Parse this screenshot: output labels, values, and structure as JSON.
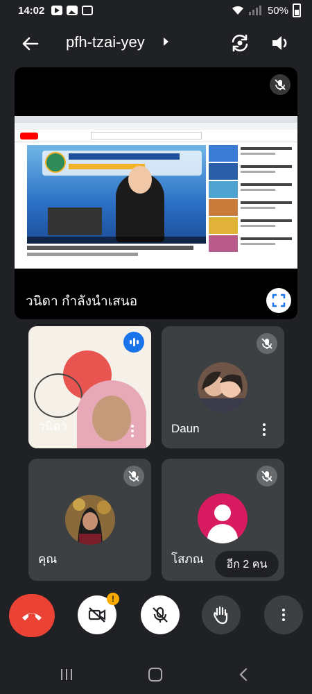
{
  "status_bar": {
    "time": "14:02",
    "battery": "50%"
  },
  "header": {
    "meeting_code": "pfh-tzai-yey"
  },
  "presenter": {
    "label": "วนิดา กำลังนำเสนอ"
  },
  "participants": [
    {
      "name": "วนิดา",
      "state": "speaking"
    },
    {
      "name": "Daun",
      "state": "muted"
    },
    {
      "name": "คุณ",
      "state": "muted"
    },
    {
      "name": "โสภณ",
      "state": "muted"
    }
  ],
  "others": {
    "label": "อีก 2 คน"
  },
  "controls": {
    "camera_warning": "!"
  },
  "colors": {
    "background": "#202124",
    "tile": "#3c4043",
    "end_call": "#ea4335",
    "speaking": "#1a73e8",
    "avatar_pink": "#d81b60",
    "warning": "#f9ab00"
  },
  "icons": [
    "back-arrow-icon",
    "caret-right-icon",
    "switch-camera-icon",
    "speaker-icon",
    "mic-off-icon",
    "fullscreen-icon",
    "speaking-icon",
    "more-vert-icon",
    "call-end-icon",
    "camera-off-icon",
    "hand-raise-icon",
    "menu-icon"
  ]
}
